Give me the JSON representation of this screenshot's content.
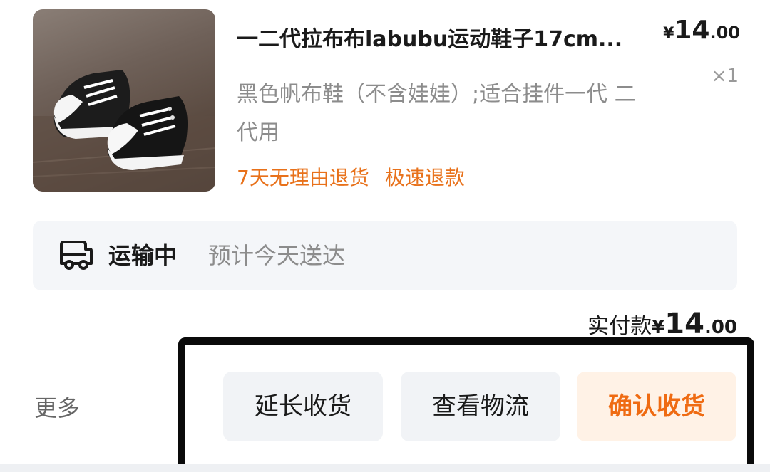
{
  "product": {
    "title": "一二代拉布布labubu运动鞋子17cm...",
    "price_currency": "¥",
    "price_int": "14",
    "price_dec": ".00",
    "quantity": "×1",
    "variant": "黑色帆布鞋（不含娃娃）;适合挂件一代 二代用",
    "tags": [
      "7天无理由退货",
      "极速退款"
    ]
  },
  "shipping": {
    "icon": "truck-icon",
    "status": "运输中",
    "eta": "预计今天送达"
  },
  "payment": {
    "label": "实付款",
    "currency": "¥",
    "int": "14",
    "dec": ".00"
  },
  "actions": {
    "more": "更多",
    "extend": "延长收货",
    "logistics": "查看物流",
    "confirm": "确认收货"
  },
  "colors": {
    "accent": "#ef6b12",
    "accent_bg": "#fff2e6",
    "button_bg": "#f1f3f6",
    "muted_text": "#8c8c8c"
  }
}
